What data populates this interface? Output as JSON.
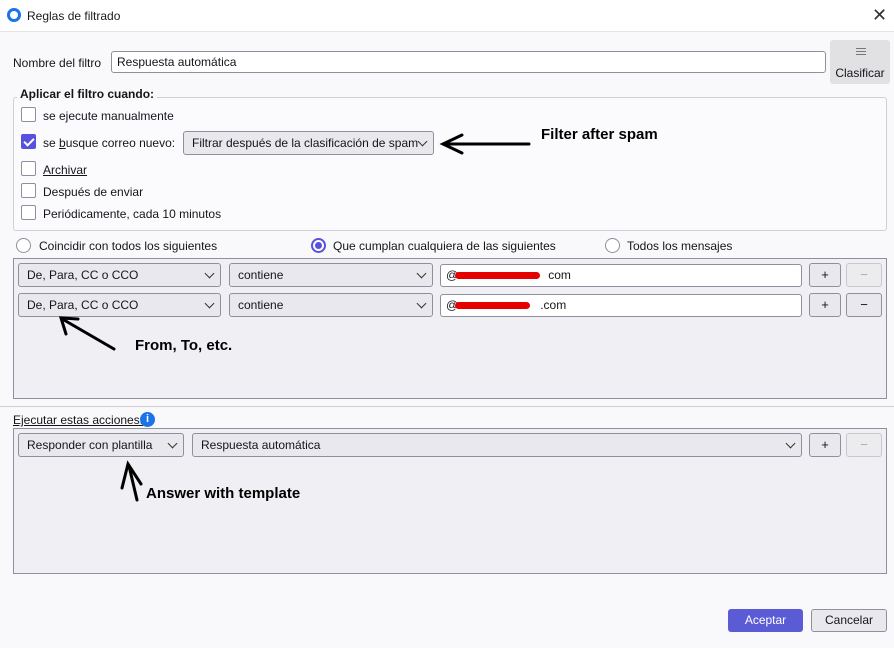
{
  "window": {
    "title": "Reglas de filtrado",
    "close": "✕"
  },
  "filter_name": {
    "label": "Nombre del filtro",
    "value": "Respuesta automática"
  },
  "sort_button": {
    "label": "Clasificar"
  },
  "apply_when": {
    "legend": "Aplicar el filtro cuando:",
    "manual": {
      "label": "se ejecute manualmente",
      "checked": false
    },
    "new_mail": {
      "label_pre": "se ",
      "label_underlined": "b",
      "label_post": "usque correo nuevo:",
      "checked": true,
      "select_value": "Filtrar después de la clasificación de spam"
    },
    "archive": {
      "label": "Archivar",
      "checked": false
    },
    "after_send": {
      "label": "Después de enviar",
      "checked": false
    },
    "periodic": {
      "label": "Periódicamente, cada 10 minutos",
      "checked": false
    }
  },
  "match": {
    "all": {
      "label": "Coincidir con todos los siguientes",
      "selected": false
    },
    "any": {
      "label": "Que cumplan cualquiera de las siguientes",
      "selected": true
    },
    "every": {
      "label": "Todos los mensajes",
      "selected": false
    }
  },
  "rules": [
    {
      "field": "De, Para, CC o CCO",
      "operator": "contiene",
      "value_prefix": "@",
      "value_suffix": "com"
    },
    {
      "field": "De, Para, CC o CCO",
      "operator": "contiene",
      "value_prefix": "@",
      "value_suffix": ".com"
    }
  ],
  "actions": {
    "label": "Ejecutar estas acciones:",
    "items": [
      {
        "action": "Responder con plantilla",
        "target": "Respuesta automática"
      }
    ]
  },
  "buttons": {
    "plus": "+",
    "minus": "−",
    "ok": "Aceptar",
    "cancel": "Cancelar"
  },
  "annotations": {
    "filter_after_spam": "Filter after spam",
    "from_to": "From, To, etc.",
    "answer_template": "Answer with template"
  },
  "colors": {
    "accent": "#5b5bd6",
    "redaction": "#e60000"
  }
}
